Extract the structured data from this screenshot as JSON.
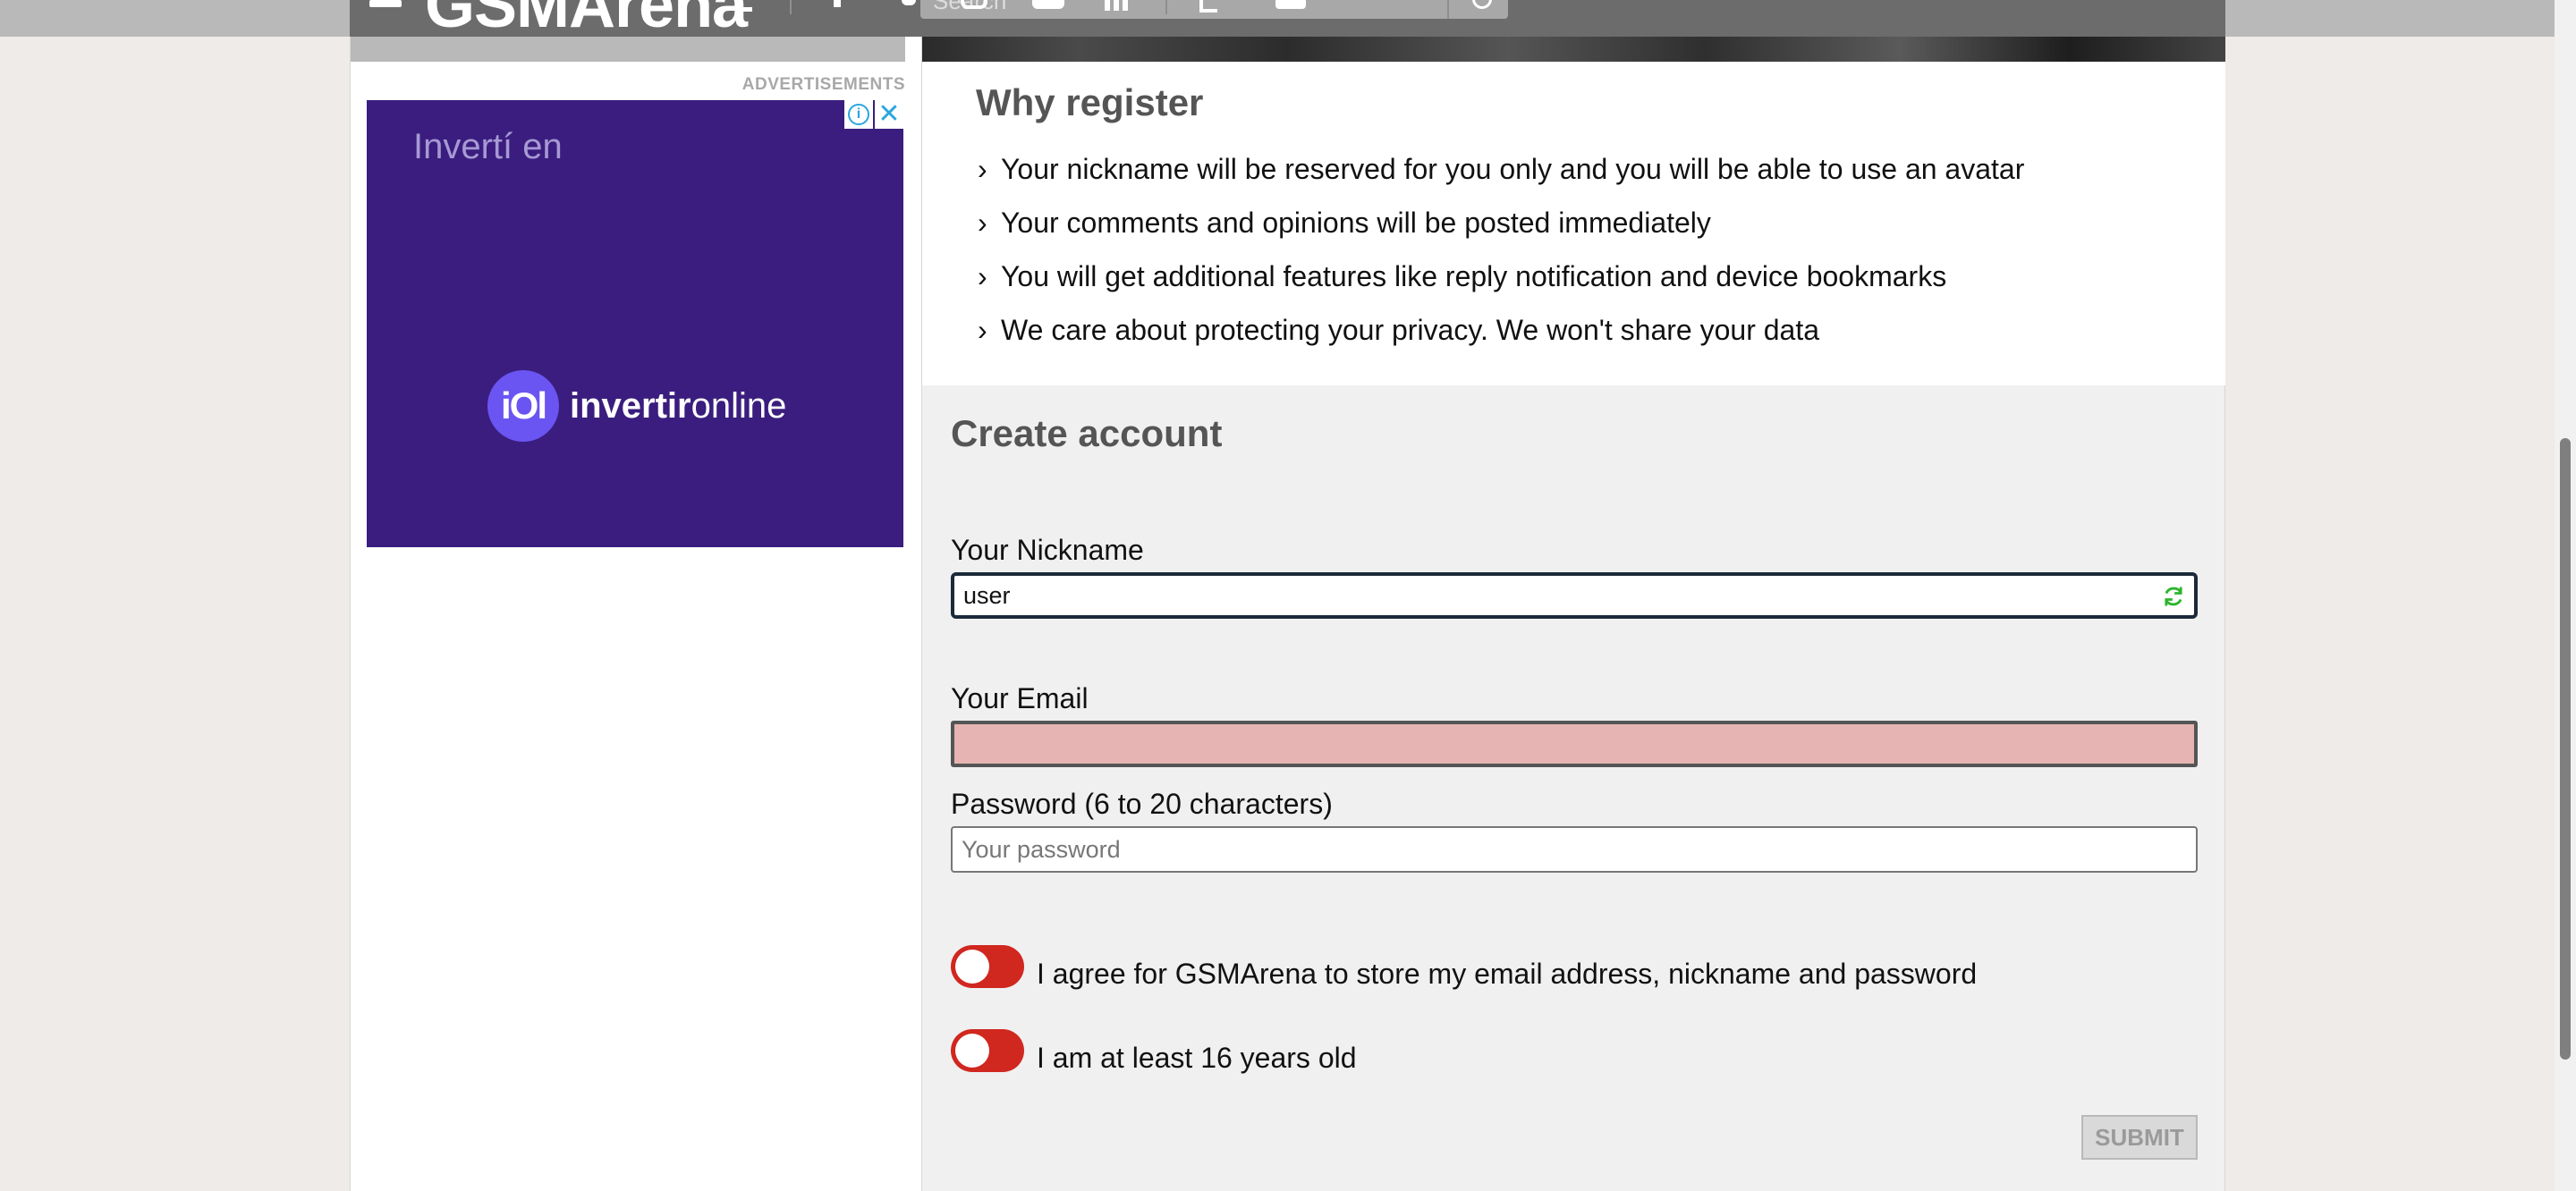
{
  "header": {
    "logo_text": "GSMArena",
    "search_placeholder": "Search"
  },
  "ads": {
    "label": "ADVERTISEMENTS",
    "headline": "Invertí en",
    "logo_mark": "iOl",
    "brand_bold": "invertir",
    "brand_rest": "online",
    "info_icon": "i",
    "close_icon": "✕"
  },
  "why": {
    "title": "Why register",
    "items": [
      "Your nickname will be reserved for you only and you will be able to use an avatar",
      "Your comments and opinions will be posted immediately",
      "You will get additional features like reply notification and device bookmarks",
      "We care about protecting your privacy. We won't share your data"
    ]
  },
  "form": {
    "title": "Create account",
    "nickname_label": "Your Nickname",
    "nickname_value": "user",
    "email_label": "Your Email",
    "email_value": "",
    "password_label": "Password (6 to 20 characters)",
    "password_placeholder": "Your password",
    "agree_label": "I agree for GSMArena to store my email address, nickname and password",
    "age_label": "I am at least 16 years old",
    "submit_label": "SUBMIT"
  },
  "colors": {
    "toggle_off": "#d0271f",
    "error_field": "#e6b4b2",
    "ad_background": "#3a1d7e"
  }
}
